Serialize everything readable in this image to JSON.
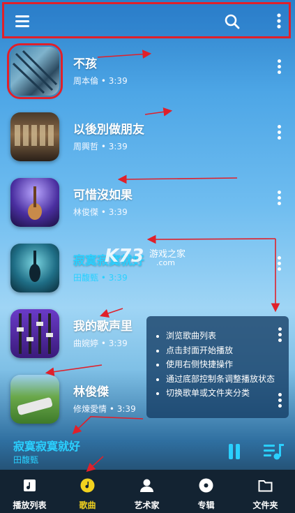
{
  "topbar": {
    "menu": "menu-icon",
    "search": "search-icon",
    "more": "more-vert-icon"
  },
  "songs": [
    {
      "title": "不孩",
      "artist": "周本倫",
      "duration": "3:39",
      "active": false
    },
    {
      "title": "以後別做朋友",
      "artist": "周興哲",
      "duration": "3:39",
      "active": false
    },
    {
      "title": "可惜沒如果",
      "artist": "林俊傑",
      "duration": "3:39",
      "active": false
    },
    {
      "title": "寂寞寂寞就好",
      "artist": "田馥甄",
      "duration": "3:39",
      "active": true
    },
    {
      "title": "我的歌声里",
      "artist": "曲婉婷",
      "duration": "3:39",
      "active": false
    },
    {
      "title": "林俊傑",
      "artist": "修煉愛情",
      "duration": "3:39",
      "active": false
    }
  ],
  "separator": "•",
  "watermark": {
    "logo": "K73",
    "site": "游戏之家",
    "domain": ".com"
  },
  "tips": [
    "浏览歌曲列表",
    "点击封面开始播放",
    "使用右侧快捷操作",
    "通过底部控制条调整播放状态",
    "切换歌单或文件夹分类"
  ],
  "now_playing": {
    "title": "寂寞寂寞就好",
    "artist": "田馥甄"
  },
  "tabs": [
    {
      "label": "播放列表",
      "icon": "playlist-icon",
      "active": false
    },
    {
      "label": "歌曲",
      "icon": "music-note-icon",
      "active": true
    },
    {
      "label": "艺术家",
      "icon": "artist-icon",
      "active": false
    },
    {
      "label": "专辑",
      "icon": "album-icon",
      "active": false
    },
    {
      "label": "文件夹",
      "icon": "folder-icon",
      "active": false
    }
  ],
  "colors": {
    "accent": "#2ad0ff",
    "active_tab": "#f2d21f",
    "annotation": "#e0202a",
    "tabbar": "#132332"
  }
}
